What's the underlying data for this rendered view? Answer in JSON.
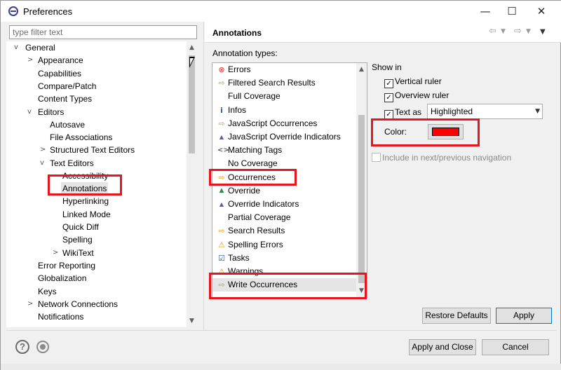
{
  "window": {
    "title": "Preferences",
    "min_glyph": "—",
    "max_glyph": "☐",
    "close_glyph": "✕"
  },
  "filter": {
    "placeholder": "type filter text"
  },
  "tree": {
    "items": [
      {
        "label": "General",
        "twisty": "v"
      },
      {
        "label": "Appearance",
        "twisty": ">"
      },
      {
        "label": "Capabilities"
      },
      {
        "label": "Compare/Patch"
      },
      {
        "label": "Content Types"
      },
      {
        "label": "Editors",
        "twisty": "v"
      },
      {
        "label": "Autosave"
      },
      {
        "label": "File Associations"
      },
      {
        "label": "Structured Text Editors",
        "twisty": ">"
      },
      {
        "label": "Text Editors",
        "twisty": "v"
      },
      {
        "label": "Accessibility"
      },
      {
        "label": "Annotations",
        "selected": true
      },
      {
        "label": "Hyperlinking"
      },
      {
        "label": "Linked Mode"
      },
      {
        "label": "Quick Diff"
      },
      {
        "label": "Spelling"
      },
      {
        "label": "WikiText",
        "twisty": ">"
      },
      {
        "label": "Error Reporting"
      },
      {
        "label": "Globalization"
      },
      {
        "label": "Keys"
      },
      {
        "label": "Network Connections",
        "twisty": ">"
      },
      {
        "label": "Notifications"
      }
    ]
  },
  "page": {
    "title": "Annotations",
    "back_icon": "back-arrow-icon",
    "forward_icon": "forward-arrow-icon",
    "menu_icon": "view-menu-icon"
  },
  "annotations": {
    "label": "Annotation types:",
    "items": [
      {
        "label": "Errors",
        "icon": "error-icon",
        "color": "#d0312d"
      },
      {
        "label": "Filtered Search Results",
        "icon": "arrow-icon",
        "color": "#d4a017"
      },
      {
        "label": "Full Coverage",
        "icon": ""
      },
      {
        "label": "Infos",
        "icon": "info-icon",
        "color": "#2a5db0"
      },
      {
        "label": "JavaScript Occurrences",
        "icon": "arrow-icon",
        "color": "#d4a017"
      },
      {
        "label": "JavaScript Override Indicators",
        "icon": "triangle-icon",
        "color": "#5a5aa8"
      },
      {
        "label": "Matching Tags",
        "icon": "tags-icon",
        "color": "#333333"
      },
      {
        "label": "No Coverage",
        "icon": ""
      },
      {
        "label": "Occurrences",
        "icon": "arrow-icon",
        "color": "#d4a017"
      },
      {
        "label": "Override",
        "icon": "override-icon",
        "color": "#2e8b57"
      },
      {
        "label": "Override Indicators",
        "icon": "triangle-icon",
        "color": "#5a5aa8"
      },
      {
        "label": "Partial Coverage",
        "icon": ""
      },
      {
        "label": "Search Results",
        "icon": "arrow-icon",
        "color": "#d4a017"
      },
      {
        "label": "Spelling Errors",
        "icon": "warning-icon",
        "color": "#d4a017"
      },
      {
        "label": "Tasks",
        "icon": "task-icon",
        "color": "#2a5db0"
      },
      {
        "label": "Warnings",
        "icon": "warning-icon",
        "color": "#d4a017"
      },
      {
        "label": "Write Occurrences",
        "icon": "arrow-icon",
        "color": "#d4a017",
        "selected": true
      }
    ]
  },
  "show_in": {
    "label": "Show in",
    "vertical_ruler": {
      "label": "Vertical ruler",
      "checked": true
    },
    "overview_ruler": {
      "label": "Overview ruler",
      "checked": true
    },
    "text_as": {
      "label": "Text as",
      "checked": true,
      "value": "Highlighted"
    },
    "color_label": "Color:",
    "color_value": "#ff0000",
    "include_nav": {
      "label": "Include in next/previous navigation",
      "checked": false,
      "enabled": false
    }
  },
  "buttons": {
    "restore_defaults": "Restore Defaults",
    "apply": "Apply",
    "apply_and_close": "Apply and Close",
    "cancel": "Cancel",
    "help_glyph": "?"
  },
  "highlight_color": "#e8141e"
}
